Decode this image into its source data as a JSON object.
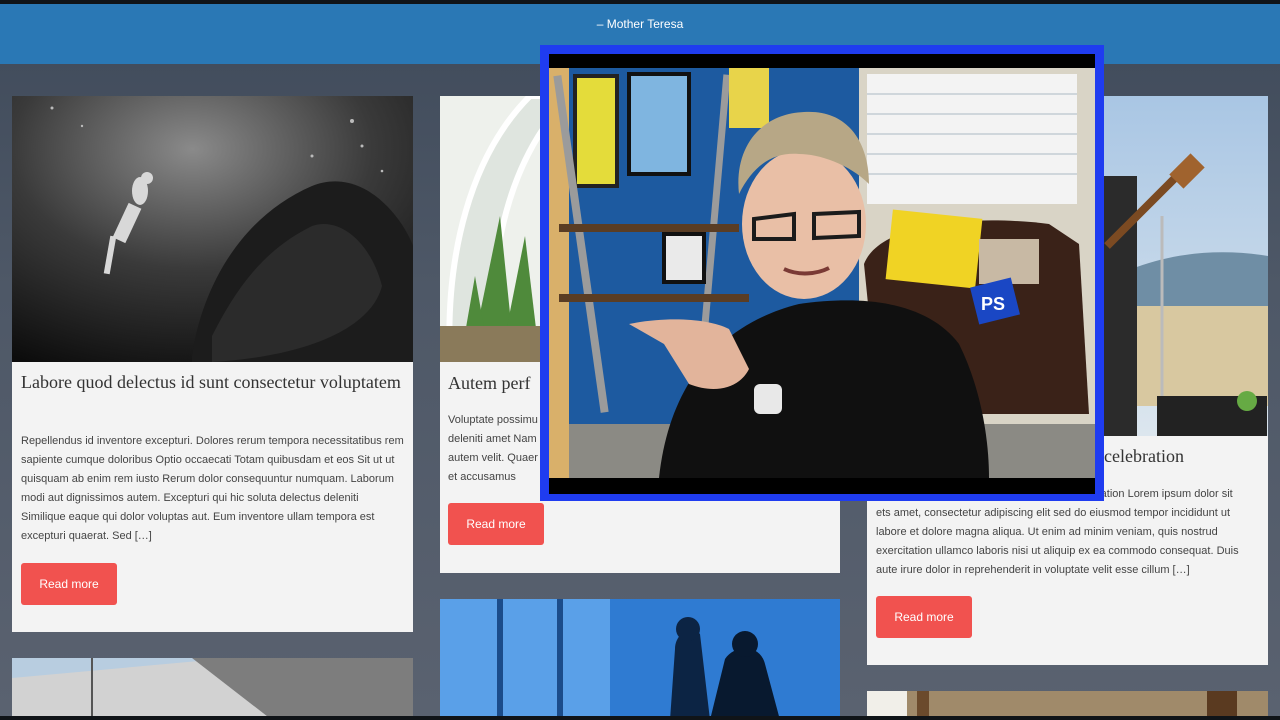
{
  "header": {
    "quote_author": "– Mother Teresa"
  },
  "cards": [
    {
      "title": "Labore quod delectus id sunt consectetur voluptatem",
      "excerpt": "Repellendus id inventore excepturi. Dolores rerum tempora necessitatibus rem sapiente cumque doloribus Optio occaecati Totam quibusdam et eos Sit ut ut quisquam ab enim rem iusto Rerum dolor consequuntur numquam. Laborum modi aut dignissimos autem. Excepturi qui hic soluta delectus deleniti Similique eaque qui dolor voluptas aut. Eum inventore ullam tempora est excepturi quaerat. Sed […]",
      "read_more": "Read more"
    },
    {
      "title": "Autem perf",
      "excerpt": "Voluptate possimu deleniti amet Nam autem velit. Quaer et accusamus",
      "read_more": "Read more"
    },
    {
      "title": "celebration",
      "excerpt": "ets amet, consectetur adipiscing elit sed do eiusmod tempor incididunt ut labore et dolore magna aliqua. Ut enim ad minim veniam, quis nostrud exercitation ullamco laboris nisi ut aliquip ex ea commodo consequat. Duis aute irure dolor in reprehenderit in voluptate velit esse cillum […]",
      "excerpt_prefix": "ration Lorem ipsum dolor sit",
      "read_more": "Read more"
    }
  ],
  "video": {
    "badge_text": "PS"
  },
  "colors": {
    "header": "#2a78b5",
    "button": "#f1524f",
    "video_border": "#1f3cf0"
  }
}
